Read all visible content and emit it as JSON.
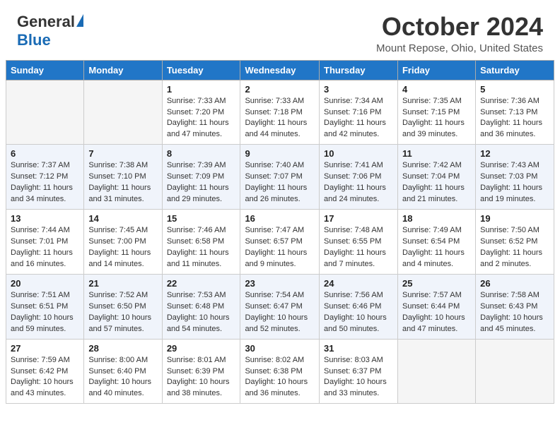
{
  "header": {
    "logo_general": "General",
    "logo_blue": "Blue",
    "month_title": "October 2024",
    "location": "Mount Repose, Ohio, United States"
  },
  "days_of_week": [
    "Sunday",
    "Monday",
    "Tuesday",
    "Wednesday",
    "Thursday",
    "Friday",
    "Saturday"
  ],
  "weeks": [
    [
      {
        "day": "",
        "info": ""
      },
      {
        "day": "",
        "info": ""
      },
      {
        "day": "1",
        "info": "Sunrise: 7:33 AM\nSunset: 7:20 PM\nDaylight: 11 hours and 47 minutes."
      },
      {
        "day": "2",
        "info": "Sunrise: 7:33 AM\nSunset: 7:18 PM\nDaylight: 11 hours and 44 minutes."
      },
      {
        "day": "3",
        "info": "Sunrise: 7:34 AM\nSunset: 7:16 PM\nDaylight: 11 hours and 42 minutes."
      },
      {
        "day": "4",
        "info": "Sunrise: 7:35 AM\nSunset: 7:15 PM\nDaylight: 11 hours and 39 minutes."
      },
      {
        "day": "5",
        "info": "Sunrise: 7:36 AM\nSunset: 7:13 PM\nDaylight: 11 hours and 36 minutes."
      }
    ],
    [
      {
        "day": "6",
        "info": "Sunrise: 7:37 AM\nSunset: 7:12 PM\nDaylight: 11 hours and 34 minutes."
      },
      {
        "day": "7",
        "info": "Sunrise: 7:38 AM\nSunset: 7:10 PM\nDaylight: 11 hours and 31 minutes."
      },
      {
        "day": "8",
        "info": "Sunrise: 7:39 AM\nSunset: 7:09 PM\nDaylight: 11 hours and 29 minutes."
      },
      {
        "day": "9",
        "info": "Sunrise: 7:40 AM\nSunset: 7:07 PM\nDaylight: 11 hours and 26 minutes."
      },
      {
        "day": "10",
        "info": "Sunrise: 7:41 AM\nSunset: 7:06 PM\nDaylight: 11 hours and 24 minutes."
      },
      {
        "day": "11",
        "info": "Sunrise: 7:42 AM\nSunset: 7:04 PM\nDaylight: 11 hours and 21 minutes."
      },
      {
        "day": "12",
        "info": "Sunrise: 7:43 AM\nSunset: 7:03 PM\nDaylight: 11 hours and 19 minutes."
      }
    ],
    [
      {
        "day": "13",
        "info": "Sunrise: 7:44 AM\nSunset: 7:01 PM\nDaylight: 11 hours and 16 minutes."
      },
      {
        "day": "14",
        "info": "Sunrise: 7:45 AM\nSunset: 7:00 PM\nDaylight: 11 hours and 14 minutes."
      },
      {
        "day": "15",
        "info": "Sunrise: 7:46 AM\nSunset: 6:58 PM\nDaylight: 11 hours and 11 minutes."
      },
      {
        "day": "16",
        "info": "Sunrise: 7:47 AM\nSunset: 6:57 PM\nDaylight: 11 hours and 9 minutes."
      },
      {
        "day": "17",
        "info": "Sunrise: 7:48 AM\nSunset: 6:55 PM\nDaylight: 11 hours and 7 minutes."
      },
      {
        "day": "18",
        "info": "Sunrise: 7:49 AM\nSunset: 6:54 PM\nDaylight: 11 hours and 4 minutes."
      },
      {
        "day": "19",
        "info": "Sunrise: 7:50 AM\nSunset: 6:52 PM\nDaylight: 11 hours and 2 minutes."
      }
    ],
    [
      {
        "day": "20",
        "info": "Sunrise: 7:51 AM\nSunset: 6:51 PM\nDaylight: 10 hours and 59 minutes."
      },
      {
        "day": "21",
        "info": "Sunrise: 7:52 AM\nSunset: 6:50 PM\nDaylight: 10 hours and 57 minutes."
      },
      {
        "day": "22",
        "info": "Sunrise: 7:53 AM\nSunset: 6:48 PM\nDaylight: 10 hours and 54 minutes."
      },
      {
        "day": "23",
        "info": "Sunrise: 7:54 AM\nSunset: 6:47 PM\nDaylight: 10 hours and 52 minutes."
      },
      {
        "day": "24",
        "info": "Sunrise: 7:56 AM\nSunset: 6:46 PM\nDaylight: 10 hours and 50 minutes."
      },
      {
        "day": "25",
        "info": "Sunrise: 7:57 AM\nSunset: 6:44 PM\nDaylight: 10 hours and 47 minutes."
      },
      {
        "day": "26",
        "info": "Sunrise: 7:58 AM\nSunset: 6:43 PM\nDaylight: 10 hours and 45 minutes."
      }
    ],
    [
      {
        "day": "27",
        "info": "Sunrise: 7:59 AM\nSunset: 6:42 PM\nDaylight: 10 hours and 43 minutes."
      },
      {
        "day": "28",
        "info": "Sunrise: 8:00 AM\nSunset: 6:40 PM\nDaylight: 10 hours and 40 minutes."
      },
      {
        "day": "29",
        "info": "Sunrise: 8:01 AM\nSunset: 6:39 PM\nDaylight: 10 hours and 38 minutes."
      },
      {
        "day": "30",
        "info": "Sunrise: 8:02 AM\nSunset: 6:38 PM\nDaylight: 10 hours and 36 minutes."
      },
      {
        "day": "31",
        "info": "Sunrise: 8:03 AM\nSunset: 6:37 PM\nDaylight: 10 hours and 33 minutes."
      },
      {
        "day": "",
        "info": ""
      },
      {
        "day": "",
        "info": ""
      }
    ]
  ]
}
